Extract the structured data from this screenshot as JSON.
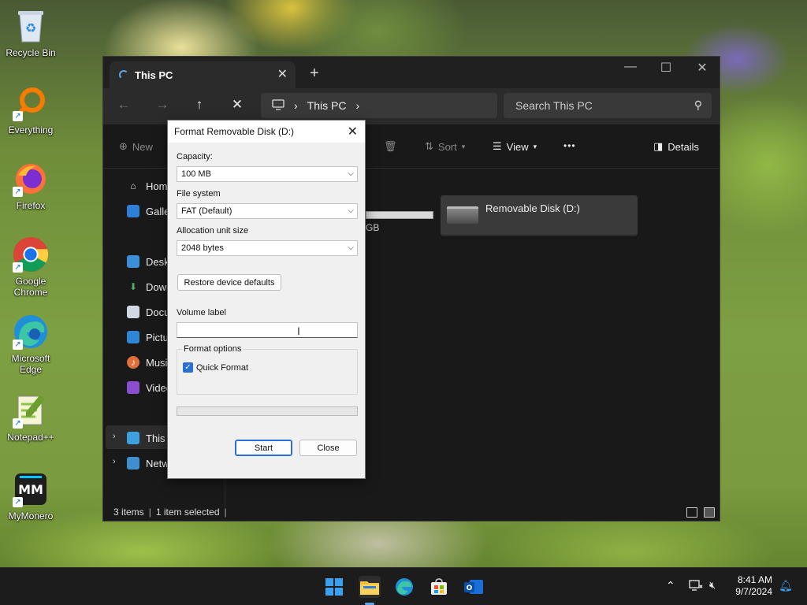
{
  "desktop": {
    "icons": [
      {
        "label": "Recycle Bin",
        "icon": "recycle-bin-icon"
      },
      {
        "label": "Everything",
        "icon": "everything-search-icon"
      },
      {
        "label": "Firefox",
        "icon": "firefox-icon"
      },
      {
        "label": "Google Chrome",
        "icon": "chrome-icon"
      },
      {
        "label": "Microsoft Edge",
        "icon": "edge-icon"
      },
      {
        "label": "Notepad++",
        "icon": "notepadpp-icon"
      },
      {
        "label": "MyMonero",
        "icon": "mymonero-icon"
      }
    ]
  },
  "explorer": {
    "tab_title": "This PC",
    "breadcrumb": "This PC",
    "search_placeholder": "Search This PC",
    "toolbar": {
      "new_label": "New",
      "sort_label": "Sort",
      "view_label": "View",
      "more_label": "•••",
      "details_label": "Details"
    },
    "sidebar": {
      "home": "Hom",
      "gallery": "Galle",
      "desktop": "Deskt",
      "downloads": "Down",
      "documents": "Docu",
      "pictures": "Pictu",
      "music": "Music",
      "videos": "Video",
      "this_pc": "This I",
      "network": "Netw"
    },
    "drive_name": "Removable Disk (D:)",
    "partial_drive_text": "GB",
    "status": {
      "items": "3 items",
      "selected": "1 item selected"
    }
  },
  "dialog": {
    "title": "Format Removable Disk (D:)",
    "capacity_label": "Capacity:",
    "capacity_value": "100 MB",
    "filesystem_label": "File system",
    "filesystem_value": "FAT (Default)",
    "alloc_label": "Allocation unit size",
    "alloc_value": "2048 bytes",
    "restore_button": "Restore device defaults",
    "volume_label": "Volume label",
    "volume_value": "",
    "format_options_label": "Format options",
    "quick_format_label": "Quick Format",
    "quick_format_checked": true,
    "progress": 0,
    "start_button": "Start",
    "close_button": "Close"
  },
  "taskbar": {
    "time": "8:41 AM",
    "date": "9/7/2024"
  },
  "colors": {
    "accent": "#2a6fd6",
    "explorer_bg": "#191919",
    "dialog_bg": "#f0f0f0",
    "taskbar_bg": "#1c1c1c"
  }
}
